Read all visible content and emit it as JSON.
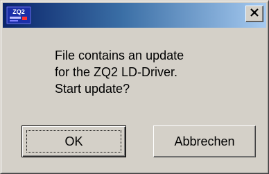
{
  "titlebar": {
    "app_icon_text": "ZQ2",
    "close_icon": "close-x-icon",
    "gradient_start": "#0a246a",
    "gradient_end": "#a6caf0"
  },
  "message": {
    "lines": [
      "File contains an update",
      "for the ZQ2 LD-Driver.",
      "Start update?"
    ]
  },
  "buttons": {
    "ok_label": "OK",
    "cancel_label": "Abbrechen"
  }
}
